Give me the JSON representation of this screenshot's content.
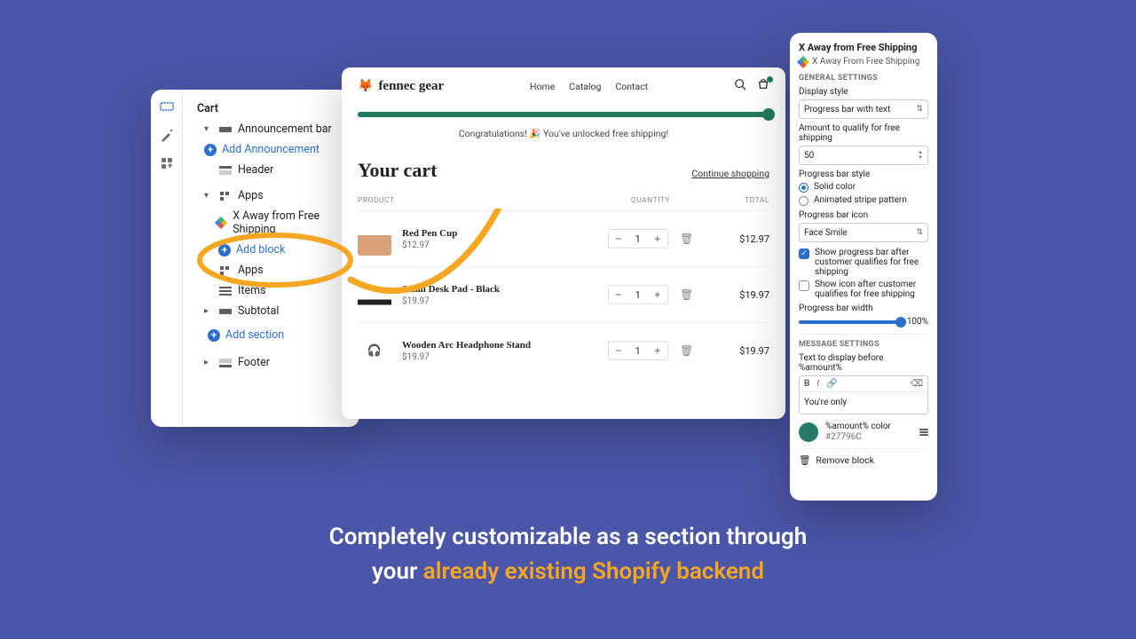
{
  "sidebar": {
    "heading": "Cart",
    "announcement_bar": "Announcement bar",
    "add_announcement": "Add Announcement",
    "header": "Header",
    "apps": "Apps",
    "x_away": "X Away from Free Shipping",
    "add_block": "Add block",
    "apps2": "Apps",
    "items": "Items",
    "subtotal": "Subtotal",
    "add_section": "Add section",
    "footer": "Footer"
  },
  "preview": {
    "brand": "fennec gear",
    "nav": {
      "home": "Home",
      "catalog": "Catalog",
      "contact": "Contact"
    },
    "progress_msg": "Congratulations! 🎉 You've unlocked free shipping!",
    "cart_title": "Your cart",
    "continue": "Continue shopping",
    "head": {
      "product": "PRODUCT",
      "quantity": "QUANTITY",
      "total": "TOTAL"
    },
    "rows": [
      {
        "name": "Red Pen Cup",
        "price": "$12.97",
        "qty": "1",
        "total": "$12.97"
      },
      {
        "name": "Small Desk Pad - Black",
        "price": "$19.97",
        "qty": "1",
        "total": "$19.97"
      },
      {
        "name": "Wooden Arc Headphone Stand",
        "price": "$19.97",
        "qty": "1",
        "total": "$19.97"
      }
    ]
  },
  "settings": {
    "title": "X Away from Free Shipping",
    "app_label": "X Away From Free Shipping",
    "general": "GENERAL SETTINGS",
    "display_style_label": "Display style",
    "display_style_value": "Progress bar with text",
    "amount_label": "Amount to qualify for free shipping",
    "amount_value": "50",
    "pbar_style_label": "Progress bar style",
    "radio_solid": "Solid color",
    "radio_stripe": "Animated stripe pattern",
    "pbar_icon_label": "Progress bar icon",
    "pbar_icon_value": "Face Smile",
    "check_show_bar": "Show progress bar after customer qualifies for free shipping",
    "check_show_icon": "Show icon after customer qualifies for free shipping",
    "pbar_width_label": "Progress bar width",
    "pbar_width_value": "100%",
    "message_section": "MESSAGE SETTINGS",
    "text_before_label": "Text to display before %amount%",
    "text_before_value": "You're only",
    "color_label": "%amount% color",
    "color_value": "#27796C",
    "remove": "Remove block"
  },
  "caption": {
    "line1a": "Completely customizable as a section through",
    "line2a": "your ",
    "line2b": "already existing Shopify backend"
  }
}
